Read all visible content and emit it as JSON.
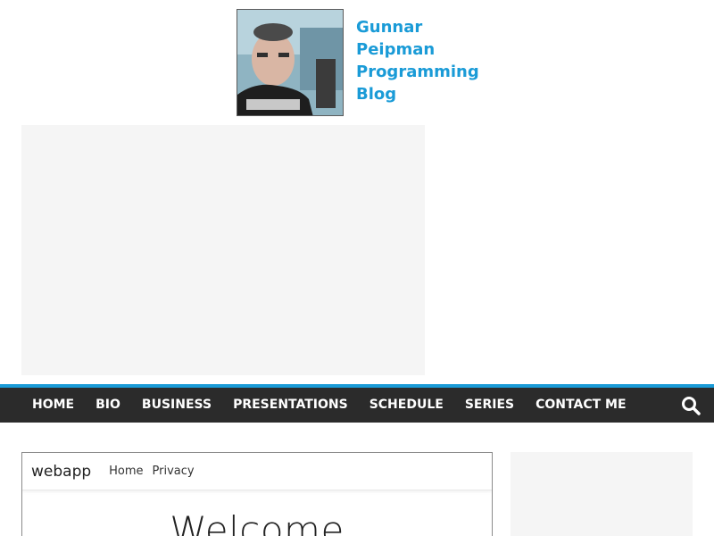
{
  "site": {
    "title": "Gunnar Peipman Programming Blog"
  },
  "nav": {
    "items": [
      "HOME",
      "BIO",
      "BUSINESS",
      "PRESENTATIONS",
      "SCHEDULE",
      "SERIES",
      "CONTACT ME"
    ],
    "search_icon": "search-icon"
  },
  "colors": {
    "accent": "#1a9bd7",
    "nav_bg": "#2b2b2b",
    "ad_bg": "#f5f5f5"
  },
  "article_screenshot": {
    "brand": "webapp",
    "links": [
      "Home",
      "Privacy"
    ],
    "heading": "Welcome"
  }
}
